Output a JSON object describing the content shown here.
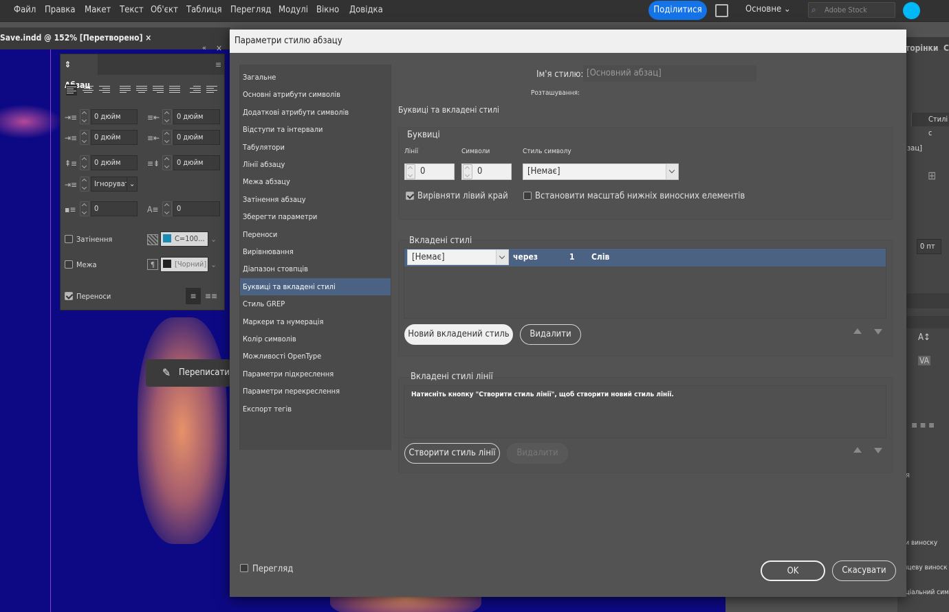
{
  "menubar": {
    "items": [
      "Файл",
      "Правка",
      "Макет",
      "Текст",
      "Об'єкт",
      "Таблиця",
      "Перегляд",
      "Модулі",
      "Вікно",
      "Довідка"
    ],
    "share": "Поділитися",
    "workspace": "Основне",
    "stock_placeholder": "Adobe Stock"
  },
  "document": {
    "tab": "Save.indd @ 152% [Перетворено]",
    "close": "×"
  },
  "paragraph_panel": {
    "title": "Абзац",
    "indent_left": "0 дюйм",
    "indent_right": "0 дюйм",
    "first_line": "0 дюйм",
    "last_line": "0 дюйм",
    "space_before": "0 дюйм",
    "space_after": "0 дюйм",
    "grid": "Ігнорувати",
    "drop_lines": "0",
    "drop_chars": "0",
    "shading_label": "Затінення",
    "shading_color": "C=100...",
    "border_label": "Межа",
    "border_color": "[Чорний]",
    "hyphenation_label": "Переноси",
    "shading_checked": false,
    "border_checked": false,
    "hyphenation_checked": true
  },
  "rewrite_button": "Переписати",
  "right_panel": {
    "partial_label_1": "торінки",
    "partial_label_2": "С",
    "styles_tab": "Стилі с",
    "bracket_text": "зац]",
    "pt_value": "0 пт",
    "footnote_1": "ти виноску",
    "footnote_2": "інцеву виноск",
    "footnote_3": "еціальний сим",
    "ya": "я"
  },
  "dialog": {
    "title": "Параметри стилю абзацу",
    "nav": [
      "Загальне",
      "Основні атрибути символів",
      "Додаткові атрибути символів",
      "Відступи та інтервали",
      "Табулятори",
      "Лінії абзацу",
      "Межа абзацу",
      "Затінення абзацу",
      "Зберегти параметри",
      "Переноси",
      "Вирівнювання",
      "Діапазон стовпців",
      "Буквиці та вкладені стилі",
      "Стиль GREP",
      "Маркери та нумерація",
      "Колір символів",
      "Можливості OpenType",
      "Параметри підкреслення",
      "Параметри перекреслення",
      "Експорт тегів"
    ],
    "selected_nav_index": 12,
    "style_name_label": "Ім'я стилю:",
    "style_name_value": "[Основний абзац]",
    "location_label": "Розташування:",
    "section_title": "Буквиці та вкладені стилі",
    "drop_caps": {
      "title": "Буквиці",
      "lines_label": "Лінії",
      "lines_value": "0",
      "chars_label": "Символи",
      "chars_value": "0",
      "char_style_label": "Стиль символу",
      "char_style_value": "[Немає]",
      "align_left_label": "Вирівняти лівий край",
      "align_left_checked": true,
      "scale_label": "Встановити масштаб нижніх виносних елементів",
      "scale_checked": false
    },
    "nested_styles": {
      "title": "Вкладені стилі",
      "row": {
        "style": "[Немає]",
        "through": "через",
        "count": "1",
        "unit": "Слів"
      },
      "new_button": "Новий вкладений стиль",
      "delete_button": "Видалити"
    },
    "nested_line_styles": {
      "title": "Вкладені стилі лінії",
      "hint": "Натисніть кнопку \"Створити стиль лінії\", щоб створити новий стиль лінії.",
      "create_button": "Створити стиль лінії",
      "delete_button": "Видалити"
    },
    "preview_label": "Перегляд",
    "preview_checked": false,
    "ok": "OK",
    "cancel": "Скасувати"
  },
  "colors": {
    "canvas": "#0d0985",
    "accent": "#1473e6",
    "selection": "#4b6283",
    "guide": "#8b3fe0"
  }
}
